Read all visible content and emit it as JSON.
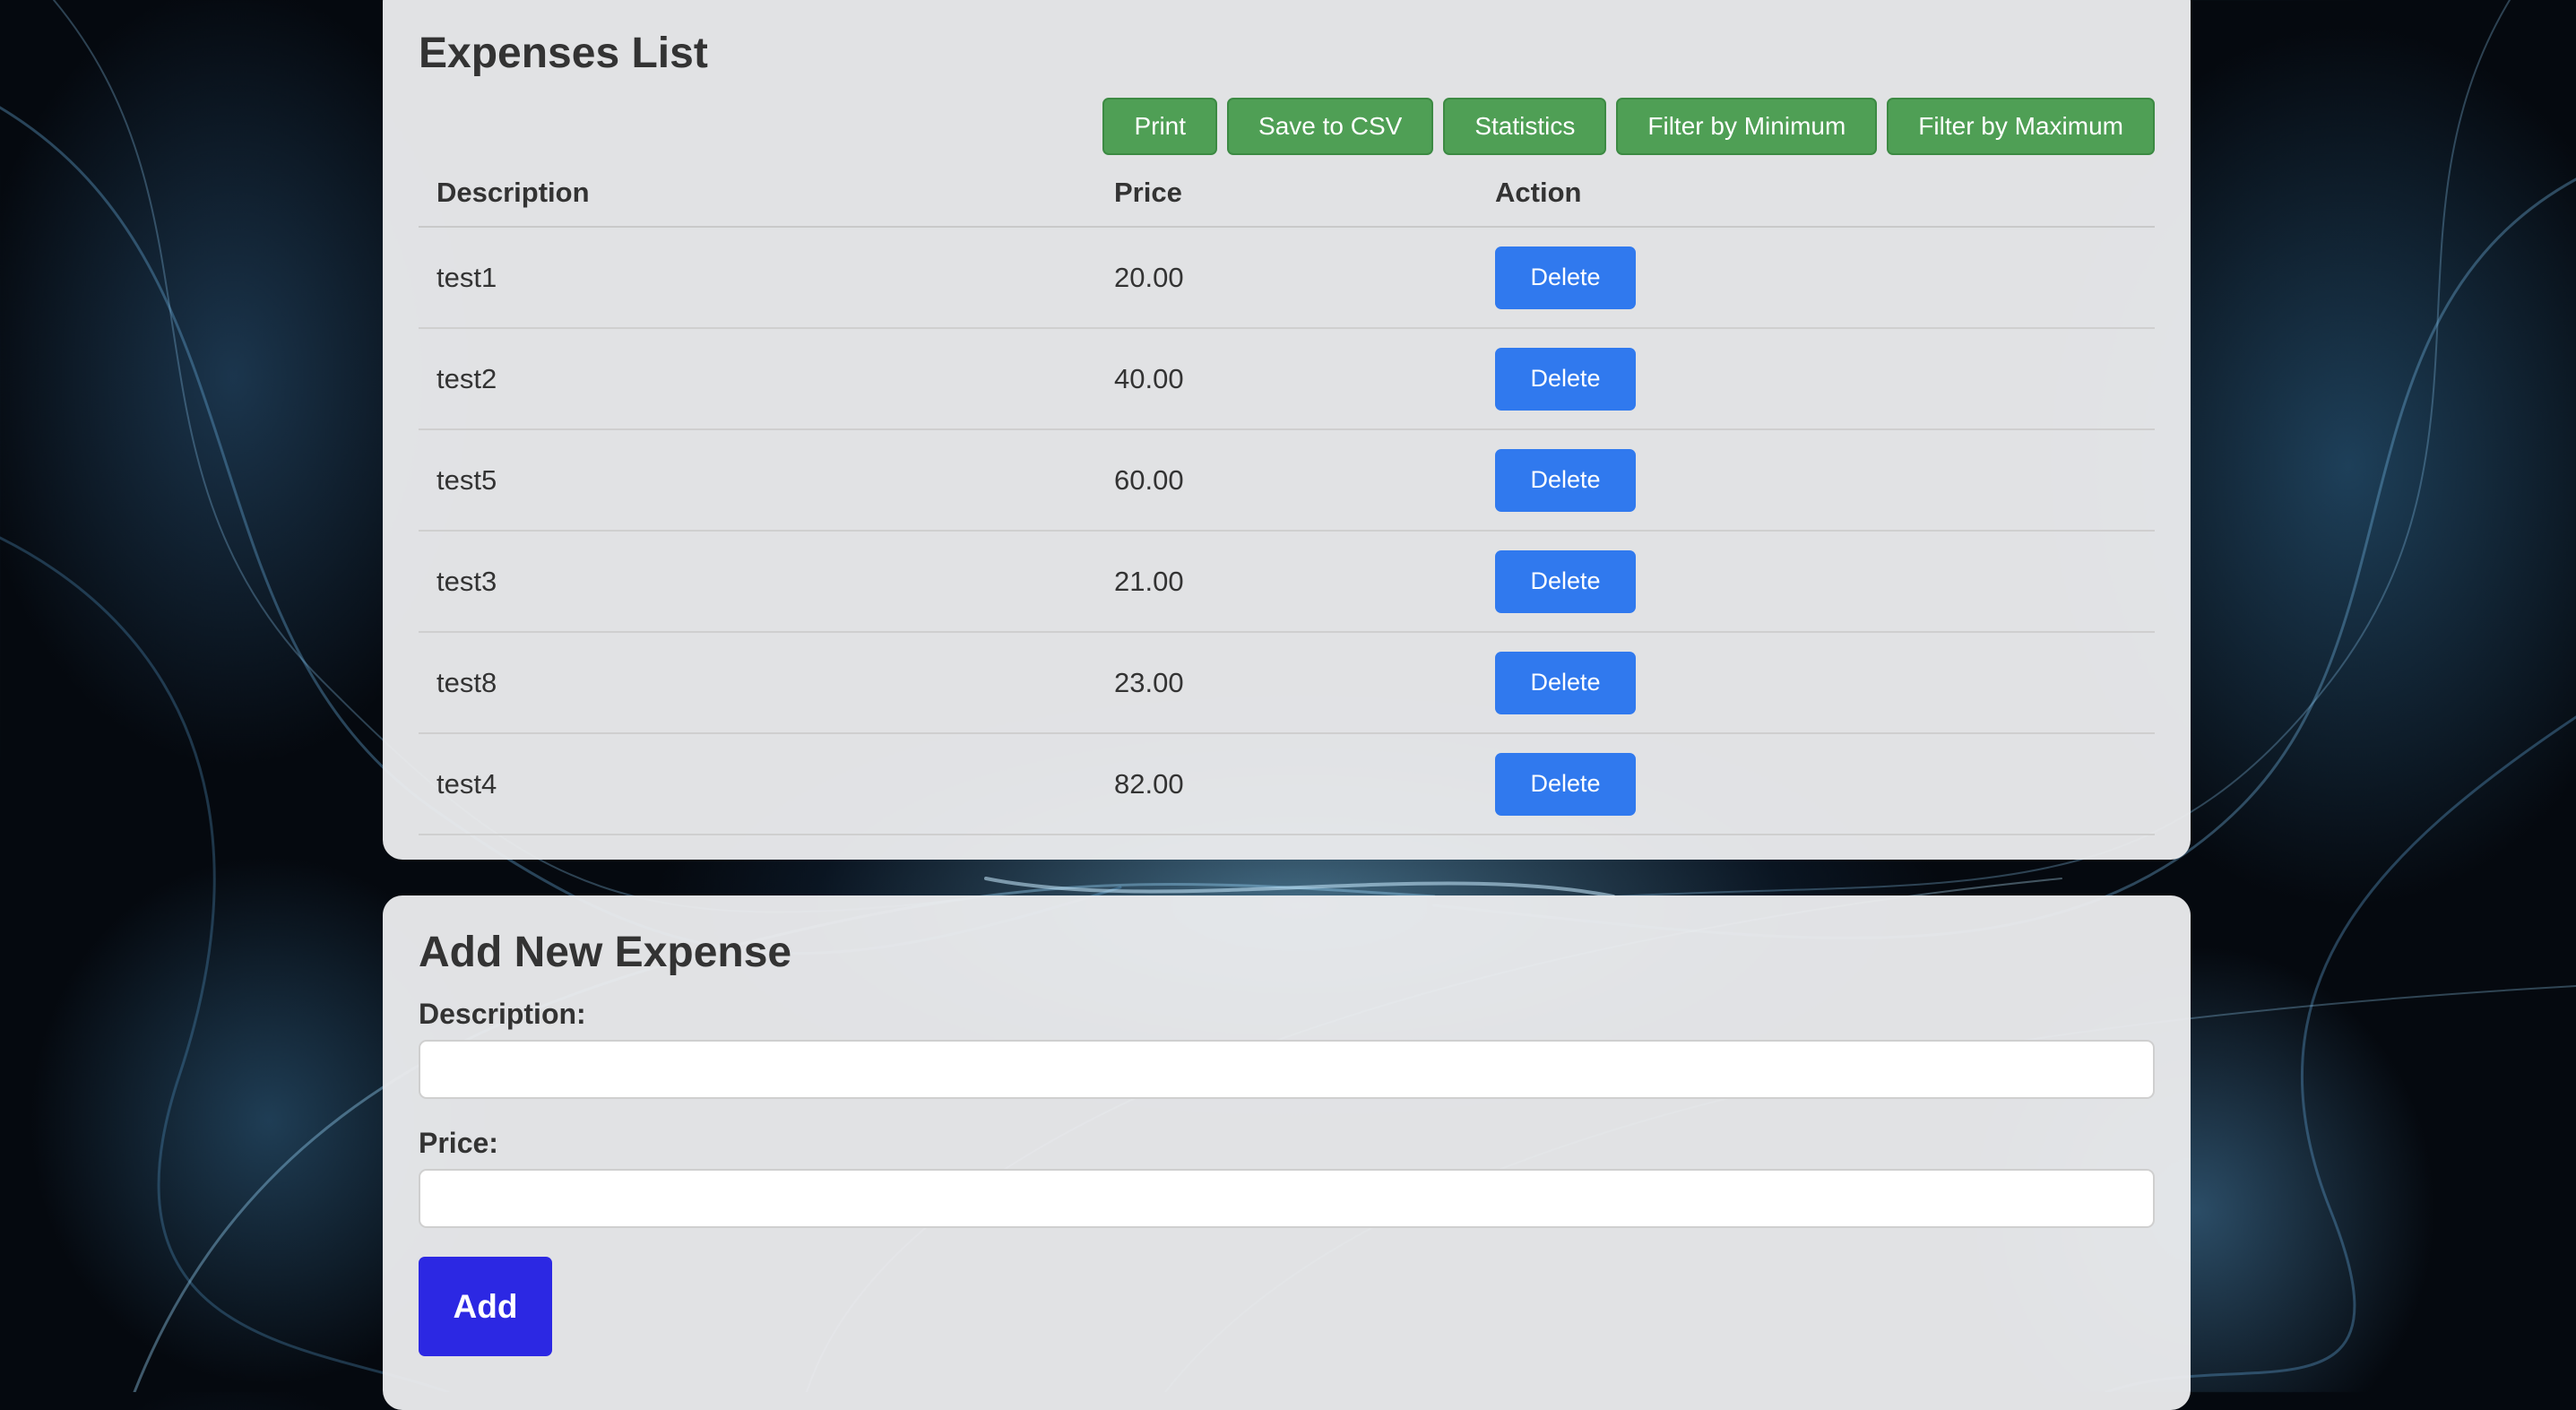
{
  "expenses_list": {
    "title": "Expenses List",
    "toolbar": [
      {
        "label": "Print",
        "name": "print-button"
      },
      {
        "label": "Save to CSV",
        "name": "save-to-csv-button"
      },
      {
        "label": "Statistics",
        "name": "statistics-button"
      },
      {
        "label": "Filter by Minimum",
        "name": "filter-by-minimum-button"
      },
      {
        "label": "Filter by Maximum",
        "name": "filter-by-maximum-button"
      }
    ],
    "columns": [
      "Description",
      "Price",
      "Action"
    ],
    "rows": [
      {
        "description": "test1",
        "price": "20.00",
        "action": "Delete"
      },
      {
        "description": "test2",
        "price": "40.00",
        "action": "Delete"
      },
      {
        "description": "test5",
        "price": "60.00",
        "action": "Delete"
      },
      {
        "description": "test3",
        "price": "21.00",
        "action": "Delete"
      },
      {
        "description": "test8",
        "price": "23.00",
        "action": "Delete"
      },
      {
        "description": "test4",
        "price": "82.00",
        "action": "Delete"
      }
    ]
  },
  "add_expense": {
    "title": "Add New Expense",
    "description_label": "Description:",
    "description_value": "",
    "price_label": "Price:",
    "price_value": "",
    "add_label": "Add"
  },
  "colors": {
    "toolbar_button": "#4f9f55",
    "delete_button": "#3079ee",
    "add_button": "#2c28e3",
    "background": "#05090f"
  }
}
